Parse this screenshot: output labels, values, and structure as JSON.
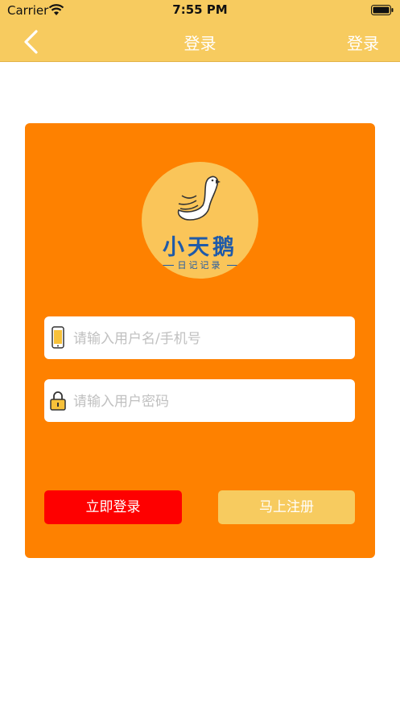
{
  "status_bar": {
    "carrier": "Carrier",
    "time": "7:55 PM"
  },
  "nav": {
    "title": "登录",
    "right_label": "登录"
  },
  "logo": {
    "name": "小天鹅",
    "tagline": "日记记录"
  },
  "form": {
    "username_placeholder": "请输入用户名/手机号",
    "password_placeholder": "请输入用户密码",
    "username_value": "",
    "password_value": ""
  },
  "buttons": {
    "login_label": "立即登录",
    "register_label": "马上注册"
  },
  "colors": {
    "bar": "#f7cb5f",
    "card": "#fe8100",
    "login_button": "#fe0000",
    "register_button": "#f7cb5f",
    "logo_bg": "#fac559",
    "logo_text": "#1f5aa8"
  }
}
